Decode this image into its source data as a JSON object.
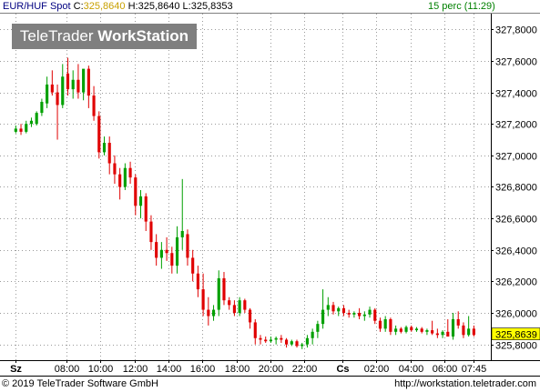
{
  "header": {
    "instrument": "EUR/HUF Spot",
    "close_label": "C:",
    "close_value": "325,8640",
    "high_label": "H:",
    "high_value": "325,8640",
    "low_label": "L:",
    "low_value": "325,8353",
    "interval": "15 perc (11:29)"
  },
  "logo": {
    "part1": "TeleTrader ",
    "part2": "WorkStation"
  },
  "footer": {
    "copyright": "© 2019 TeleTrader Software GmbH",
    "url": "http://workstation.teletrader.com"
  },
  "colors": {
    "up": "#00a000",
    "down": "#e00000",
    "grid": "#9a9a9a",
    "last_price_bg": "#ffff00"
  },
  "chart_data": {
    "type": "candlestick",
    "y_ticks": [
      "327,8000",
      "327,6000",
      "327,4000",
      "327,2000",
      "327,0000",
      "326,8000",
      "326,6000",
      "326,4000",
      "326,2000",
      "326,0000",
      "325,8000"
    ],
    "ylim": [
      325.7,
      327.9
    ],
    "last_price": "325,8639",
    "x_ticks": [
      {
        "label": "Sz",
        "t": 0,
        "bold": true
      },
      {
        "label": "08:00",
        "t": 12
      },
      {
        "label": "10:00",
        "t": 20
      },
      {
        "label": "12:00",
        "t": 28
      },
      {
        "label": "14:00",
        "t": 36
      },
      {
        "label": "16:00",
        "t": 44
      },
      {
        "label": "18:00",
        "t": 52
      },
      {
        "label": "20:00",
        "t": 60
      },
      {
        "label": "22:00",
        "t": 68
      },
      {
        "label": "Cs",
        "t": 77,
        "bold": true
      },
      {
        "label": "02:00",
        "t": 85
      },
      {
        "label": "04:00",
        "t": 93
      },
      {
        "label": "06:00",
        "t": 101
      },
      {
        "label": "07:45",
        "t": 108
      }
    ],
    "t_range": [
      -2,
      112
    ],
    "candles": [
      [
        327.15,
        327.19,
        327.14,
        327.17
      ],
      [
        327.17,
        327.2,
        327.13,
        327.15
      ],
      [
        327.15,
        327.22,
        327.14,
        327.2
      ],
      [
        327.2,
        327.24,
        327.18,
        327.22
      ],
      [
        327.2,
        327.28,
        327.19,
        327.27
      ],
      [
        327.27,
        327.36,
        327.25,
        327.34
      ],
      [
        327.33,
        327.5,
        327.3,
        327.45
      ],
      [
        327.45,
        327.54,
        327.38,
        327.4
      ],
      [
        327.4,
        327.45,
        327.1,
        327.32
      ],
      [
        327.32,
        327.58,
        327.3,
        327.5
      ],
      [
        327.52,
        327.62,
        327.38,
        327.42
      ],
      [
        327.42,
        327.54,
        327.36,
        327.48
      ],
      [
        327.48,
        327.58,
        327.36,
        327.4
      ],
      [
        327.4,
        327.52,
        327.35,
        327.55
      ],
      [
        327.55,
        327.57,
        327.3,
        327.38
      ],
      [
        327.38,
        327.44,
        327.22,
        327.25
      ],
      [
        327.25,
        327.28,
        326.98,
        327.02
      ],
      [
        327.02,
        327.12,
        327.0,
        327.08
      ],
      [
        327.08,
        327.12,
        326.88,
        326.95
      ],
      [
        326.95,
        327.0,
        326.82,
        326.88
      ],
      [
        326.88,
        326.92,
        326.72,
        326.8
      ],
      [
        326.8,
        326.95,
        326.78,
        326.92
      ],
      [
        326.92,
        326.96,
        326.82,
        326.86
      ],
      [
        326.86,
        326.88,
        326.62,
        326.68
      ],
      [
        326.68,
        326.78,
        326.6,
        326.74
      ],
      [
        326.74,
        326.76,
        326.52,
        326.58
      ],
      [
        326.58,
        326.62,
        326.4,
        326.45
      ],
      [
        326.45,
        326.5,
        326.3,
        326.35
      ],
      [
        326.35,
        326.45,
        326.28,
        326.4
      ],
      [
        326.4,
        326.48,
        326.33,
        326.38
      ],
      [
        326.38,
        326.42,
        326.25,
        326.3
      ],
      [
        326.3,
        326.55,
        326.25,
        326.48
      ],
      [
        326.48,
        326.85,
        326.4,
        326.52
      ],
      [
        326.5,
        326.53,
        326.3,
        326.35
      ],
      [
        326.35,
        326.4,
        326.2,
        326.25
      ],
      [
        326.25,
        326.3,
        326.1,
        326.15
      ],
      [
        326.15,
        326.25,
        325.98,
        326.02
      ],
      [
        326.02,
        326.1,
        325.92,
        325.98
      ],
      [
        325.98,
        326.05,
        325.95,
        326.02
      ],
      [
        326.02,
        326.27,
        325.98,
        326.22
      ],
      [
        326.22,
        326.26,
        326.05,
        326.08
      ],
      [
        326.08,
        326.1,
        326.02,
        326.05
      ],
      [
        326.05,
        326.08,
        325.98,
        326.0
      ],
      [
        326.0,
        326.1,
        325.98,
        326.08
      ],
      [
        326.08,
        326.09,
        326.0,
        326.02
      ],
      [
        326.02,
        326.03,
        325.9,
        325.94
      ],
      [
        325.94,
        325.96,
        325.8,
        325.84
      ],
      [
        325.84,
        325.86,
        325.8,
        325.83
      ],
      [
        325.83,
        325.85,
        325.81,
        325.82
      ],
      [
        325.82,
        325.85,
        325.81,
        325.83
      ],
      [
        325.83,
        325.85,
        325.8,
        325.84
      ],
      [
        325.84,
        325.86,
        325.81,
        325.83
      ],
      [
        325.83,
        325.84,
        325.78,
        325.8
      ],
      [
        325.8,
        325.83,
        325.79,
        325.82
      ],
      [
        325.82,
        325.83,
        325.78,
        325.79
      ],
      [
        325.79,
        325.81,
        325.77,
        325.8
      ],
      [
        325.8,
        325.86,
        325.78,
        325.84
      ],
      [
        325.84,
        325.9,
        325.8,
        325.88
      ],
      [
        325.88,
        325.95,
        325.84,
        325.93
      ],
      [
        325.93,
        326.15,
        325.9,
        326.02
      ],
      [
        326.02,
        326.1,
        325.98,
        326.05
      ],
      [
        326.05,
        326.07,
        325.99,
        326.01
      ],
      [
        326.01,
        326.04,
        325.98,
        326.03
      ],
      [
        326.03,
        326.05,
        325.98,
        326.0
      ],
      [
        326.0,
        326.02,
        325.97,
        325.99
      ],
      [
        325.99,
        326.01,
        325.97,
        326.0
      ],
      [
        326.0,
        326.03,
        325.96,
        325.98
      ],
      [
        325.98,
        326.01,
        325.95,
        325.99
      ],
      [
        325.99,
        326.04,
        325.97,
        326.02
      ],
      [
        326.02,
        326.03,
        325.93,
        325.95
      ],
      [
        325.95,
        325.97,
        325.88,
        325.9
      ],
      [
        325.9,
        325.98,
        325.88,
        325.96
      ],
      [
        325.96,
        325.97,
        325.86,
        325.88
      ],
      [
        325.88,
        325.92,
        325.86,
        325.9
      ],
      [
        325.9,
        325.91,
        325.87,
        325.88
      ],
      [
        325.88,
        325.92,
        325.87,
        325.91
      ],
      [
        325.91,
        325.92,
        325.88,
        325.89
      ],
      [
        325.89,
        325.91,
        325.88,
        325.9
      ],
      [
        325.9,
        325.91,
        325.87,
        325.88
      ],
      [
        325.88,
        325.9,
        325.86,
        325.89
      ],
      [
        325.89,
        325.95,
        325.86,
        325.87
      ],
      [
        325.87,
        325.9,
        325.84,
        325.86
      ],
      [
        325.86,
        325.89,
        325.84,
        325.88
      ],
      [
        325.88,
        325.96,
        325.85,
        325.85
      ],
      [
        325.85,
        326.0,
        325.83,
        325.96
      ],
      [
        325.96,
        326.01,
        325.9,
        325.92
      ],
      [
        325.92,
        325.94,
        325.84,
        325.86
      ],
      [
        325.86,
        325.98,
        325.85,
        325.9
      ],
      [
        325.9,
        325.92,
        325.85,
        325.86
      ]
    ]
  }
}
